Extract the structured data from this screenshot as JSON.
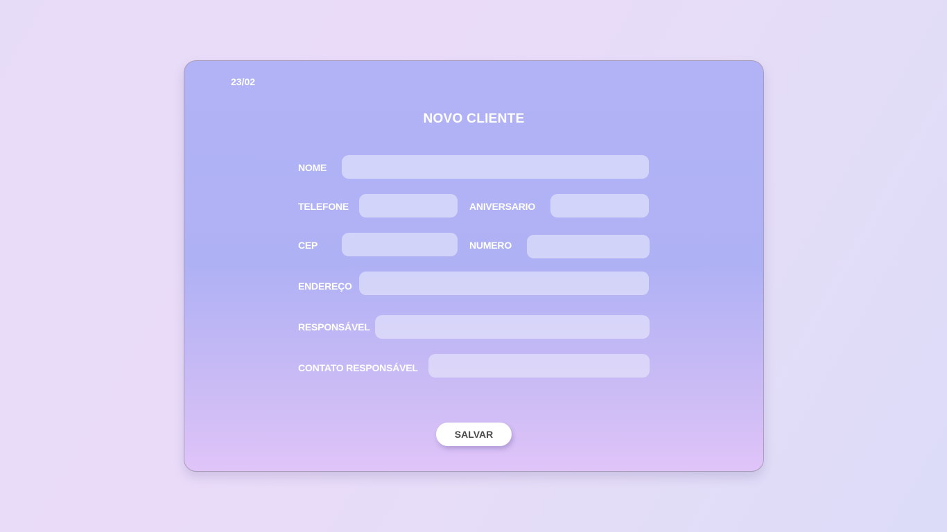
{
  "form": {
    "date": "23/02",
    "title": "NOVO CLIENTE",
    "labels": {
      "nome": "NOME",
      "telefone": "TELEFONE",
      "aniversario": "ANIVERSARIO",
      "cep": "CEP",
      "numero": "NUMERO",
      "endereco": "ENDEREÇO",
      "responsavel": "RESPONSÁVEL",
      "contato_responsavel": "CONTATO RESPONSÁVEL"
    },
    "values": {
      "nome": "",
      "telefone": "",
      "aniversario": "",
      "cep": "",
      "numero": "",
      "endereco": "",
      "responsavel": "",
      "contato_responsavel": ""
    },
    "save_label": "SALVAR"
  }
}
